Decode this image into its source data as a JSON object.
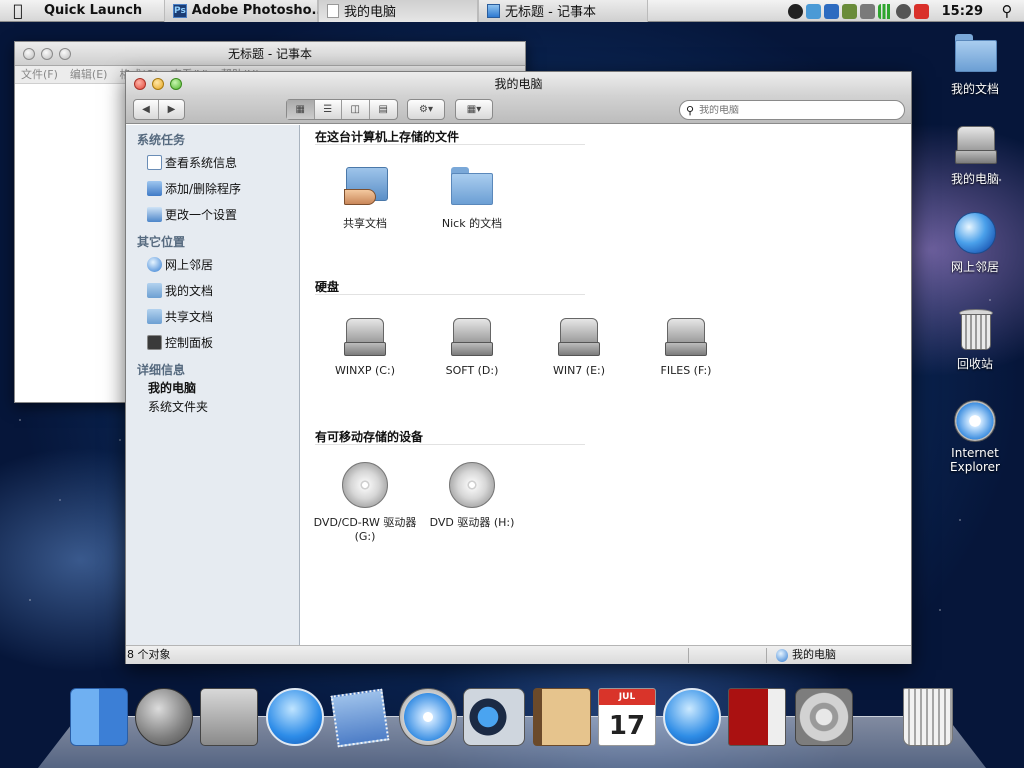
{
  "menubar": {
    "quick_launch": "Quick Launch",
    "tasks": [
      {
        "label": "Adobe Photosho..."
      },
      {
        "label": "我的电脑"
      },
      {
        "label": "无标题 - 记事本"
      }
    ],
    "clock": "15:29"
  },
  "desktop_icons": [
    {
      "label": "我的文档",
      "icon": "folder-icon"
    },
    {
      "label": "我的电脑",
      "icon": "hard-drive-icon"
    },
    {
      "label": "网上邻居",
      "icon": "globe-icon"
    },
    {
      "label": "回收站",
      "icon": "trash-icon"
    },
    {
      "label": "Internet Explorer",
      "icon": "compass-icon"
    }
  ],
  "notepad": {
    "title": "无标题 - 记事本",
    "menus": [
      "文件(F)",
      "编辑(E)",
      "格式(O)",
      "查看(V)",
      "帮助(H)"
    ]
  },
  "explorer": {
    "title": "我的电脑",
    "search_placeholder": "我的电脑",
    "sidebar": {
      "system_tasks": {
        "heading": "系统任务",
        "items": [
          "查看系统信息",
          "添加/删除程序",
          "更改一个设置"
        ]
      },
      "other_places": {
        "heading": "其它位置",
        "items": [
          "网上邻居",
          "我的文档",
          "共享文档",
          "控制面板"
        ]
      },
      "details": {
        "heading": "详细信息",
        "name": "我的电脑",
        "type": "系统文件夹"
      }
    },
    "sections": {
      "files": {
        "title": "在这台计算机上存储的文件",
        "items": [
          "共享文档",
          "Nick 的文档"
        ]
      },
      "drives": {
        "title": "硬盘",
        "items": [
          "WINXP (C:)",
          "SOFT (D:)",
          "WIN7 (E:)",
          "FILES (F:)"
        ]
      },
      "removable": {
        "title": "有可移动存储的设备",
        "items": [
          "DVD/CD-RW 驱动器 (G:)",
          "DVD 驱动器 (H:)"
        ]
      }
    },
    "status": {
      "count": "8 个对象",
      "location": "我的电脑"
    }
  },
  "dock": {
    "calendar_month": "JUL",
    "calendar_day": "17"
  },
  "colors": {
    "sidebar_bg": "#e6ebf1",
    "sidebar_heading": "#566a7f",
    "desktop_bg": "#123a78"
  }
}
